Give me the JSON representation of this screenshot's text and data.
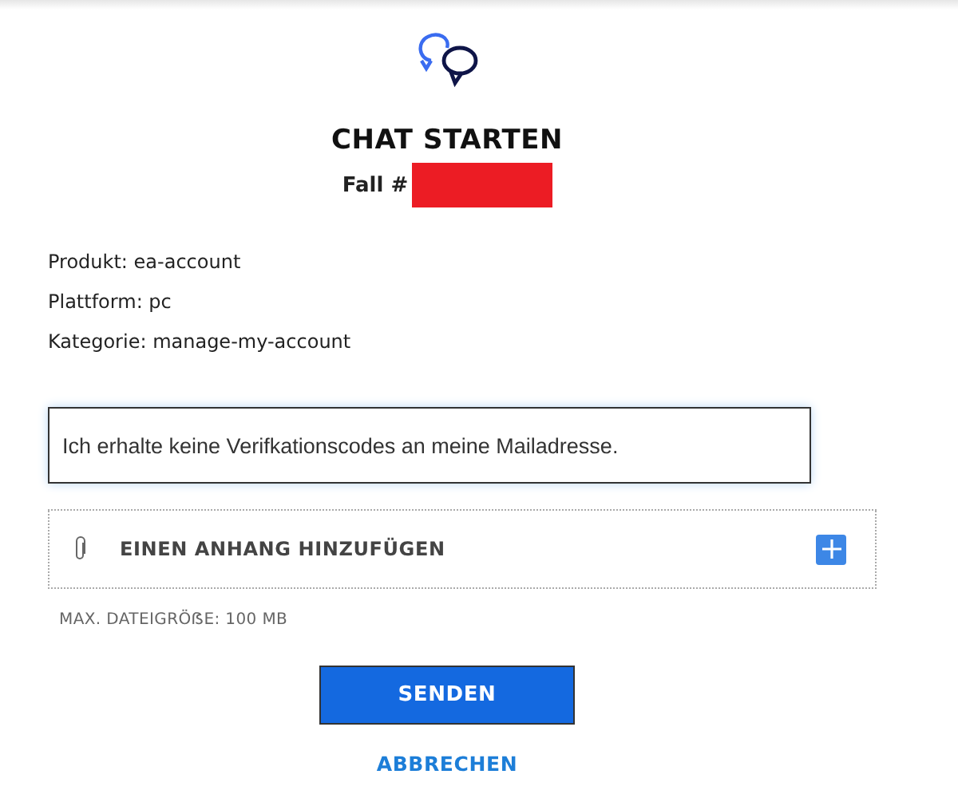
{
  "header": {
    "title": "CHAT STARTEN",
    "case_label": "Fall #"
  },
  "details": [
    "Produkt: ea-account",
    "Plattform: pc",
    "Kategorie: manage-my-account"
  ],
  "message": {
    "value": "Ich erhalte keine Verifkationscodes an meine Mailadresse."
  },
  "attachment": {
    "label": "EINEN ANHANG HINZUFÜGEN",
    "note": "MAX. DATEIGRÖẞE: 100 MB"
  },
  "buttons": {
    "submit": "SENDEN",
    "cancel": "ABBRECHEN"
  }
}
